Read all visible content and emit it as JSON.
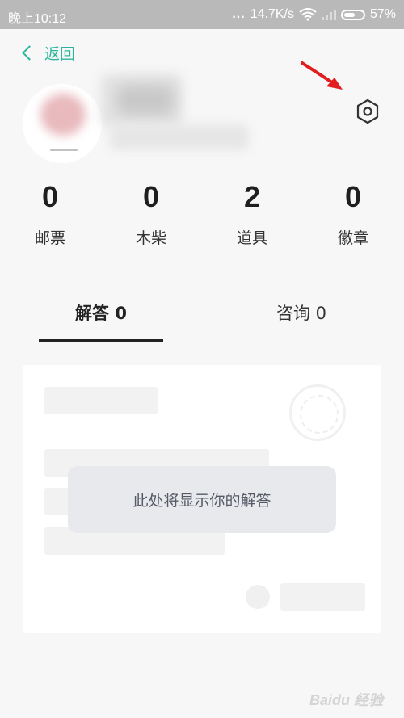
{
  "status_bar": {
    "time": "晚上10:12",
    "dots": "...",
    "speed": "14.7K/s",
    "battery": "57%",
    "battery_level": 0.57
  },
  "header": {
    "back_label": "返回"
  },
  "stats": [
    {
      "value": "0",
      "label": "邮票"
    },
    {
      "value": "0",
      "label": "木柴"
    },
    {
      "value": "2",
      "label": "道具"
    },
    {
      "value": "0",
      "label": "徽章"
    }
  ],
  "tabs": [
    {
      "label": "解答 0",
      "active": true
    },
    {
      "label": "咨询 0",
      "active": false
    }
  ],
  "empty_message": "此处将显示你的解答",
  "watermark": "Baidu 经验",
  "colors": {
    "accent": "#2bb69b",
    "arrow": "#e11d1d"
  }
}
